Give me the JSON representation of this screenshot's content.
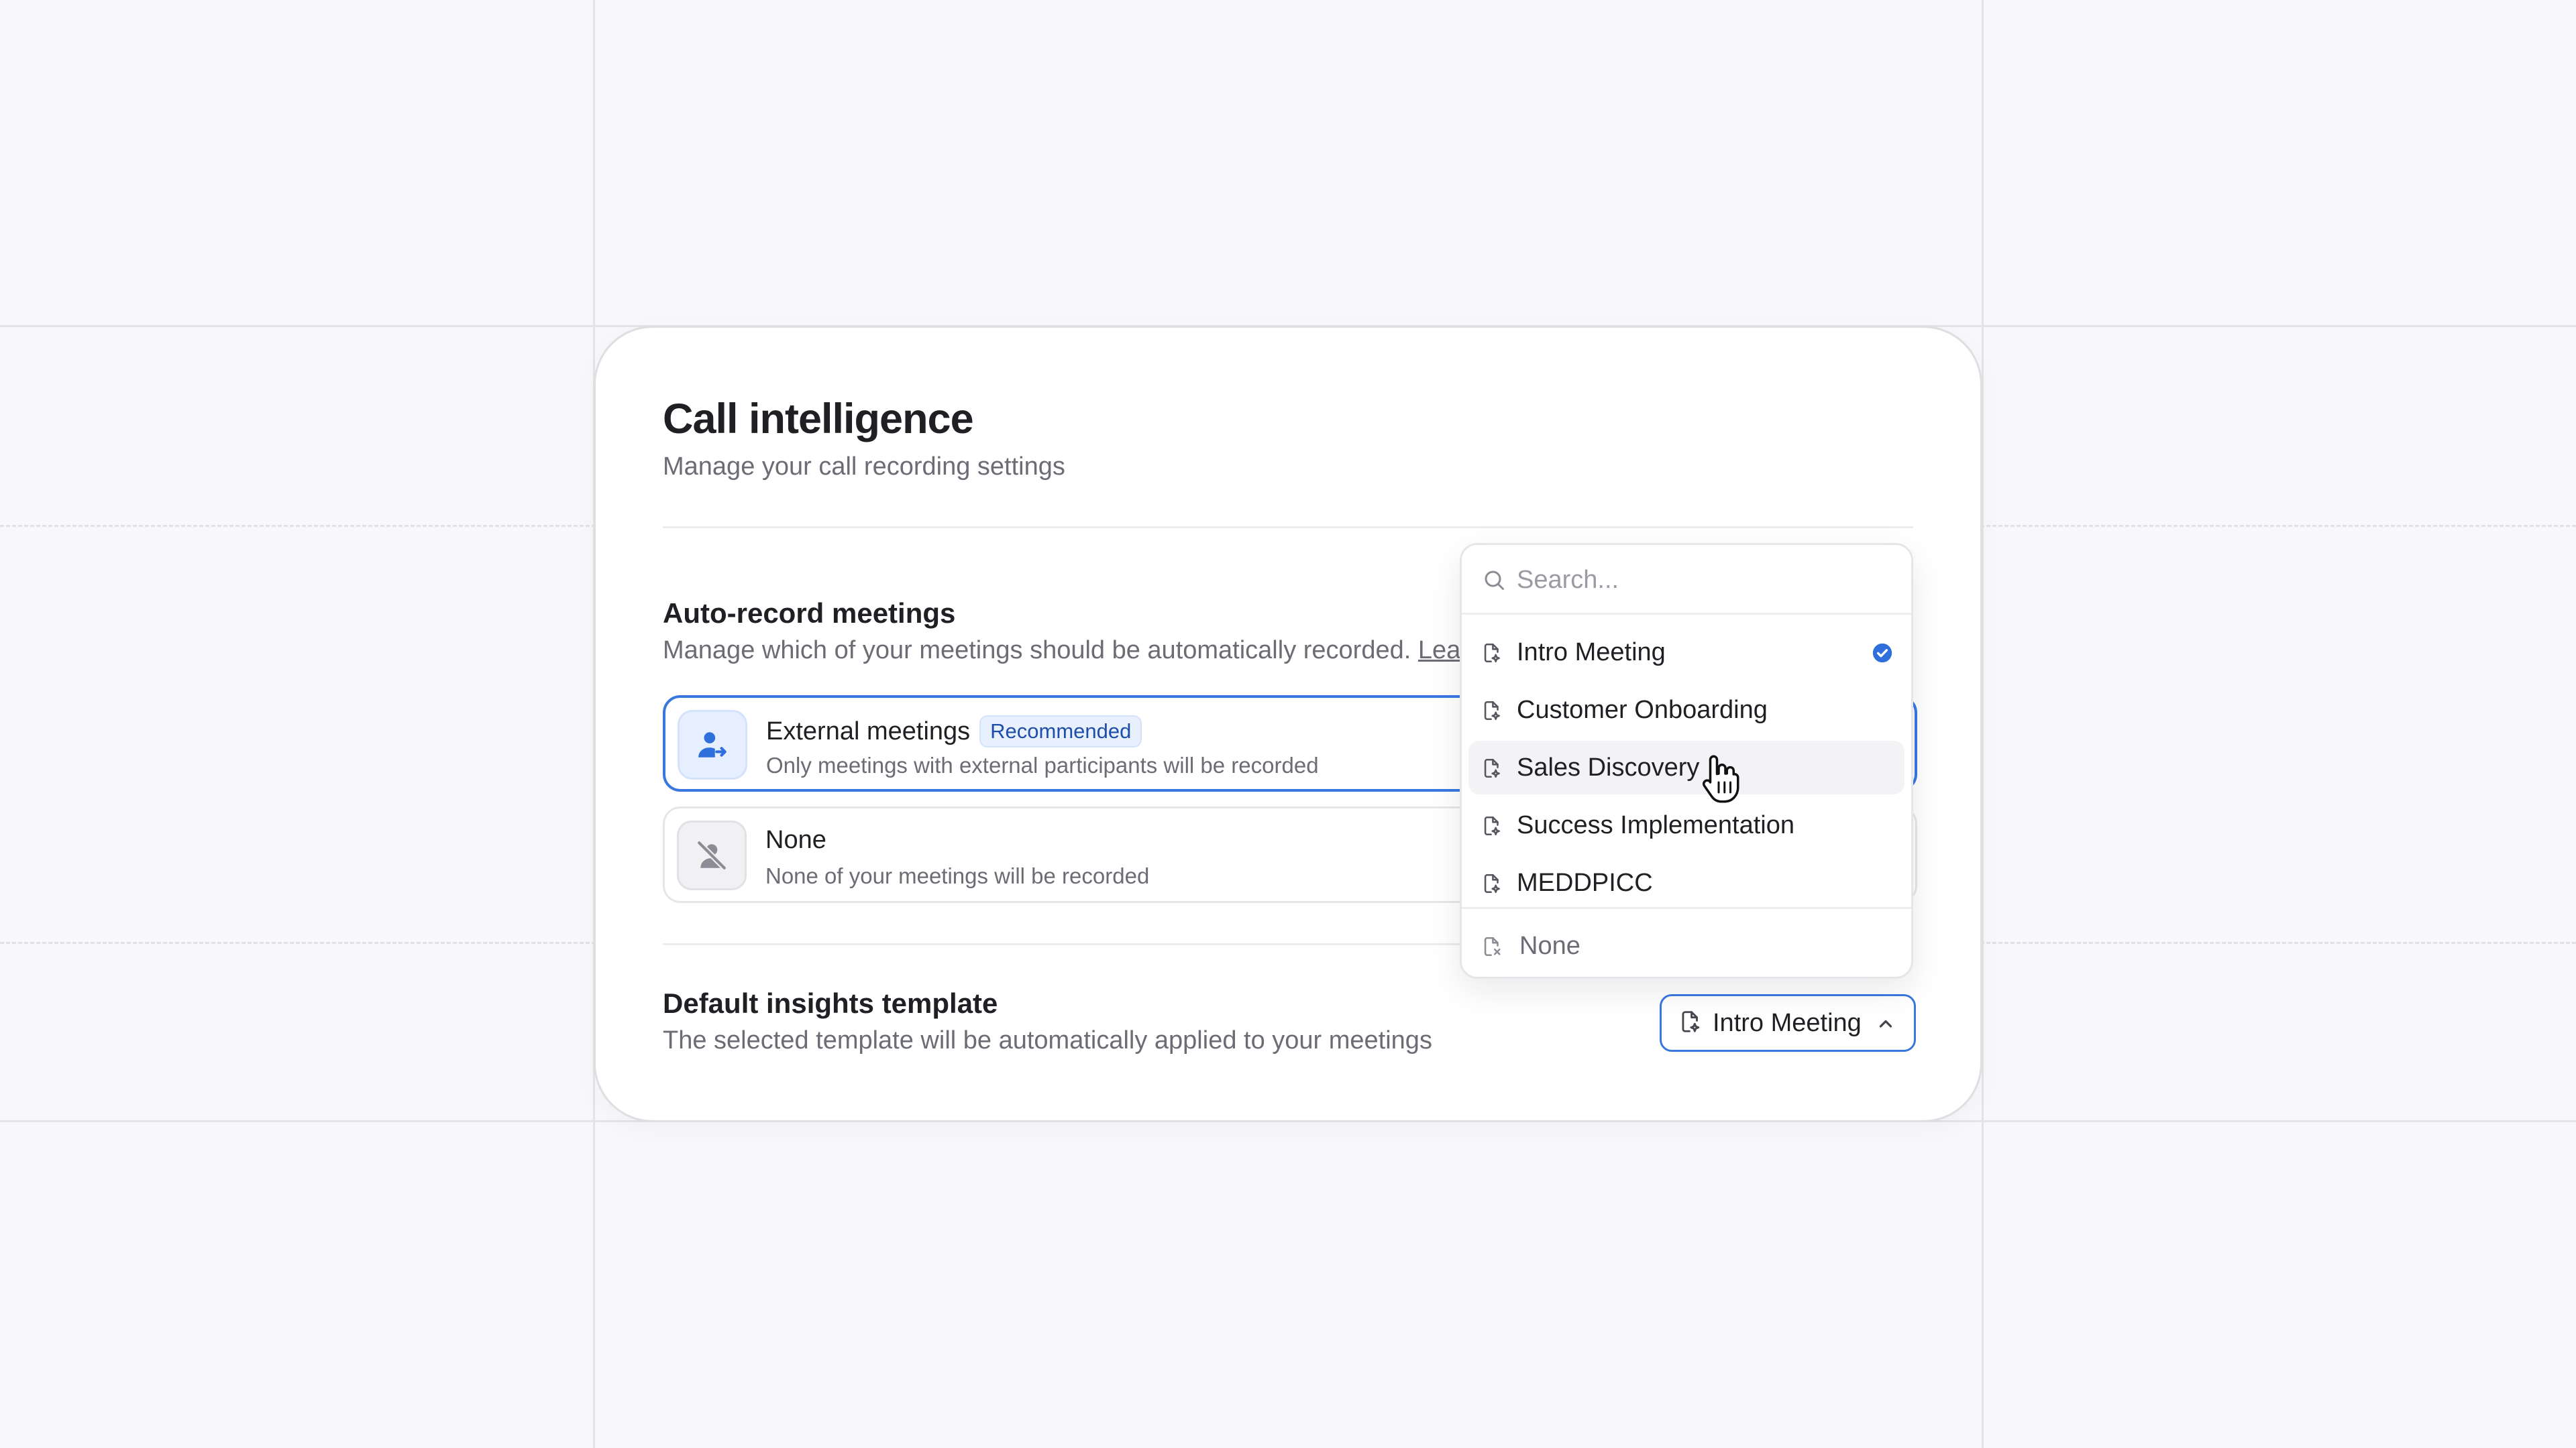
{
  "card": {
    "title": "Call intelligence",
    "subtitle": "Manage your call recording settings"
  },
  "auto_record": {
    "title": "Auto-record meetings",
    "description": "Manage which of your meetings should be automatically recorded.",
    "learn_more": "Learn more",
    "options": [
      {
        "title": "External meetings",
        "badge": "Recommended",
        "description": "Only meetings with external participants will be recorded",
        "selected": true,
        "icon": "user-arrow-icon"
      },
      {
        "title": "None",
        "description": "None of your meetings will be recorded",
        "selected": false,
        "icon": "user-slash-icon"
      }
    ]
  },
  "template": {
    "title": "Default insights template",
    "description": "The selected template will be automatically applied to your meetings",
    "selected_value": "Intro Meeting"
  },
  "dropdown": {
    "search_placeholder": "Search...",
    "items": [
      {
        "label": "Intro Meeting",
        "checked": true
      },
      {
        "label": "Customer Onboarding",
        "checked": false
      },
      {
        "label": "Sales Discovery",
        "checked": false,
        "hovered": true
      },
      {
        "label": "Success Implementation",
        "checked": false
      },
      {
        "label": "MEDDPICC",
        "checked": false
      }
    ],
    "none_label": "None"
  },
  "colors": {
    "accent": "#3a78e0",
    "badge_bg": "#e8f0fe",
    "badge_text": "#1d4fa8",
    "background": "#f8f8fa"
  }
}
